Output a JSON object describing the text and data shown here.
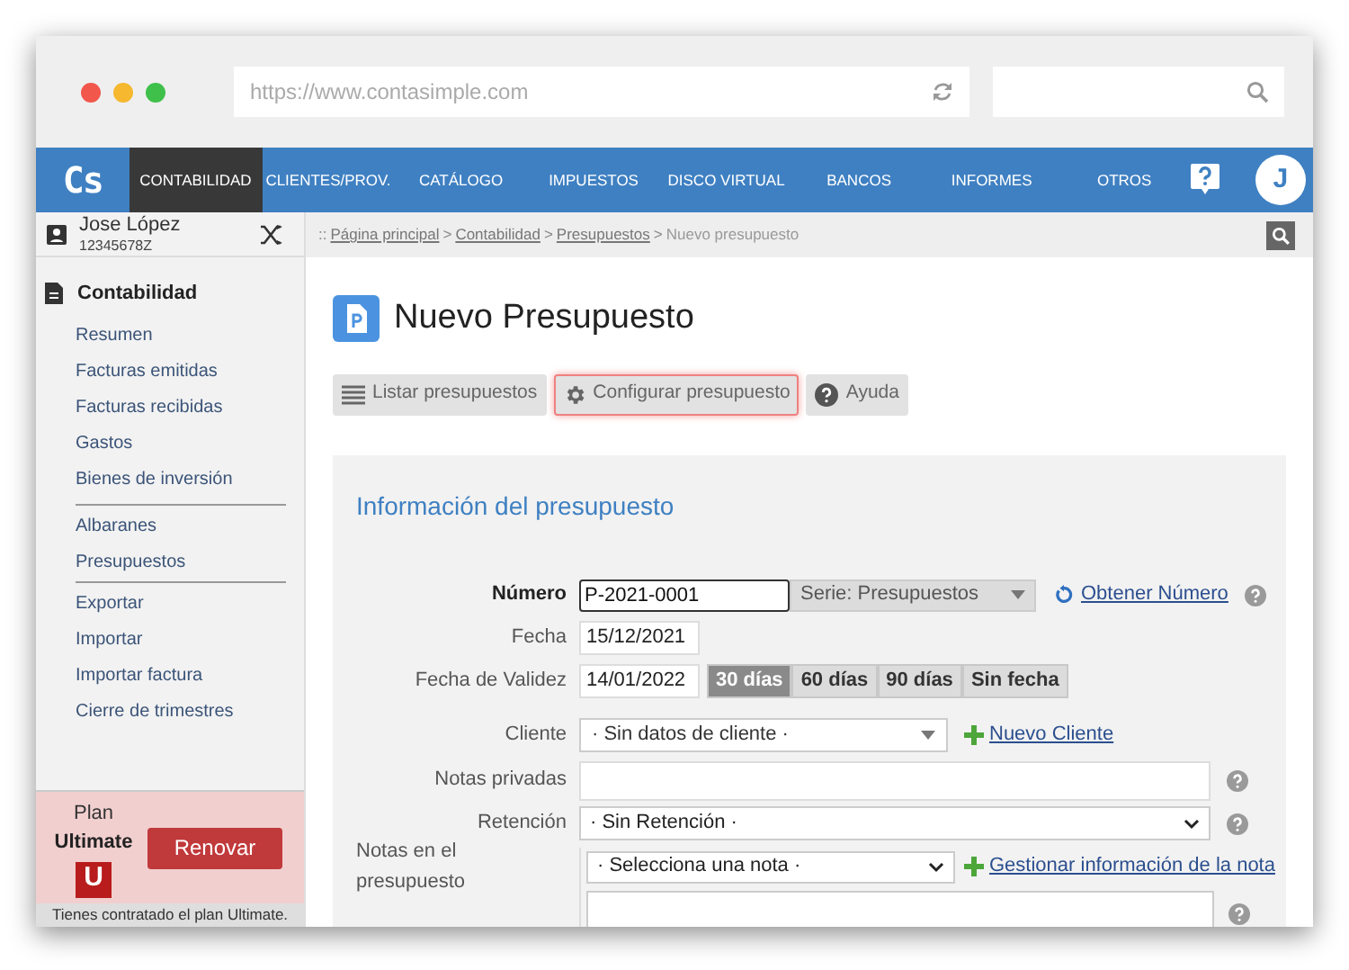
{
  "browser": {
    "url": "https://www.contasimple.com"
  },
  "nav": {
    "logo": "Cs",
    "avatar": "J",
    "items": [
      {
        "label": "CONTABILIDAD",
        "selected": true
      },
      {
        "label": "CLIENTES/PROV.",
        "selected": false
      },
      {
        "label": "CATÁLOGO",
        "selected": false
      },
      {
        "label": "IMPUESTOS",
        "selected": false
      },
      {
        "label": "DISCO VIRTUAL",
        "selected": false
      },
      {
        "label": "BANCOS",
        "selected": false
      },
      {
        "label": "INFORMES",
        "selected": false
      },
      {
        "label": "OTROS",
        "selected": false
      }
    ]
  },
  "user": {
    "name": "Jose López",
    "id": "12345678Z"
  },
  "sidebar": {
    "section": "Contabilidad",
    "groups": [
      {
        "items": [
          "Resumen",
          "Facturas emitidas",
          "Facturas recibidas",
          "Gastos",
          "Bienes de inversión"
        ]
      },
      {
        "items": [
          "Albaranes",
          "Presupuestos"
        ]
      },
      {
        "items": [
          "Exportar",
          "Importar",
          "Importar factura",
          "Cierre de trimestres"
        ]
      }
    ]
  },
  "plan": {
    "label": "Plan",
    "name": "Ultimate",
    "badge": "U",
    "button": "Renovar",
    "note": "Tienes contratado el plan Ultimate."
  },
  "breadcrumb": {
    "prefix": "::",
    "separator": ">",
    "links": [
      "Página principal",
      "Contabilidad",
      "Presupuestos"
    ],
    "current": "Nuevo presupuesto"
  },
  "page": {
    "title": "Nuevo Presupuesto"
  },
  "toolbar": [
    {
      "kind": "list",
      "label": "Listar presupuestos",
      "highlighted": false
    },
    {
      "kind": "gear",
      "label": "Configurar presupuesto",
      "highlighted": true
    },
    {
      "kind": "help",
      "label": "Ayuda",
      "highlighted": false
    }
  ],
  "form": {
    "title": "Información del presupuesto",
    "fields": [
      {
        "kind": "number",
        "label": "Número",
        "required": true,
        "value": "P-2021-0001",
        "series": "Serie: Presupuestos",
        "link": "Obtener Número",
        "help": true
      },
      {
        "kind": "date",
        "label": "Fecha",
        "required": false,
        "value": "15/12/2021",
        "help": false
      },
      {
        "kind": "validity",
        "label": "Fecha de Validez",
        "required": false,
        "value": "14/01/2022",
        "help": false,
        "options": [
          {
            "label": "30 días",
            "selected": true
          },
          {
            "label": "60 días",
            "selected": false
          },
          {
            "label": "90 días",
            "selected": false
          },
          {
            "label": "Sin fecha",
            "selected": false
          }
        ]
      },
      {
        "kind": "combo",
        "label": "Cliente",
        "required": false,
        "value": "· Sin datos de cliente ·",
        "link": "Nuevo Cliente",
        "help": false
      },
      {
        "kind": "textarea",
        "label": "Notas privadas",
        "required": false,
        "help": true
      },
      {
        "kind": "select",
        "label": "Retención",
        "required": false,
        "value": "· Sin Retención ·",
        "help": true
      },
      {
        "kind": "notes",
        "label": "Notas en el presupuesto",
        "required": false,
        "value": "· Selecciona una nota ·",
        "link": "Gestionar información de la nota",
        "help": true
      }
    ]
  }
}
